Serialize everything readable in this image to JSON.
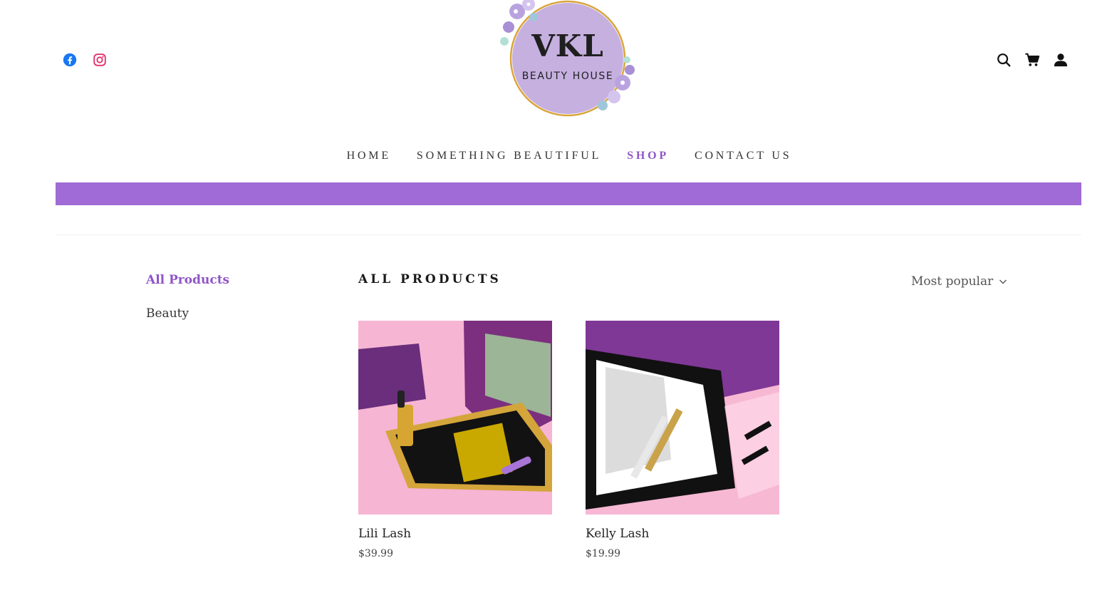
{
  "brand": {
    "logo_main": "VKL",
    "logo_sub": "BEAUTY HOUSE",
    "accent_color": "#a06bd6",
    "active_text_color": "#8f55c7"
  },
  "social": [
    {
      "icon": "facebook-icon",
      "color": "#1877f2"
    },
    {
      "icon": "instagram-icon",
      "color": "#e1306c"
    }
  ],
  "header_icons": [
    "search-icon",
    "cart-icon",
    "account-icon"
  ],
  "nav": {
    "items": [
      {
        "label": "HOME"
      },
      {
        "label": "SOMETHING BEAUTIFUL"
      },
      {
        "label": "SHOP",
        "active": true
      },
      {
        "label": "CONTACT US"
      }
    ]
  },
  "sidebar": {
    "categories": [
      {
        "label": "All Products",
        "active": true
      },
      {
        "label": "Beauty"
      }
    ]
  },
  "main": {
    "title": "ALL PRODUCTS",
    "sort_label": "Most popular"
  },
  "products": [
    {
      "name": "Lili Lash",
      "price": "$39.99"
    },
    {
      "name": "Kelly Lash",
      "price": "$19.99"
    }
  ]
}
